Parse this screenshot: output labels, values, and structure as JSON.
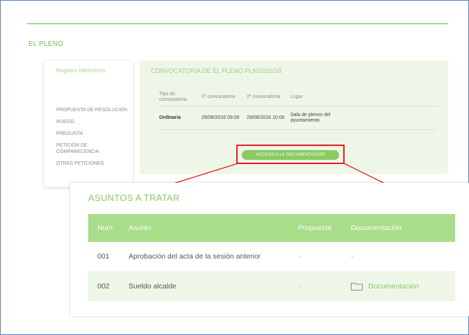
{
  "section_title": "EL PLENO",
  "sidebar": {
    "registro": "Registro electrónico",
    "items": [
      {
        "label": "PROPUESTA DE RESOLUCIÓN"
      },
      {
        "label": "RUEGO"
      },
      {
        "label": "PREGUNTA"
      },
      {
        "label": "PETICIÓN DE COMPARECENCIA"
      },
      {
        "label": "OTRAS PETICIONES"
      }
    ]
  },
  "convocatoria": {
    "title": "CONVOCATORIA DE EL PLENO PLN/2016/18",
    "headers": [
      "Tipo de convocatoria",
      "1ª convocatoria",
      "2ª convocatoria",
      "Lugar"
    ],
    "row": [
      "Ordinaria",
      "29/08/2016 09:00",
      "29/08/2016 10:00",
      "Sala de plenos del ayuntamiento"
    ],
    "button_label": "ACCESO A LA DOCUMENTACIÓN"
  },
  "asuntos": {
    "title": "ASUNTOS A TRATAR",
    "headers": [
      "Num.",
      "Asunto",
      "Propuesta",
      "Documentación"
    ],
    "rows": [
      {
        "num": "001",
        "asunto": "Aprobación del acta de la sesión anterior",
        "propuesta": "-",
        "documentacion": "-"
      },
      {
        "num": "002",
        "asunto": "Sueldo alcalde",
        "propuesta": "-",
        "documentacion": "Documentación"
      }
    ]
  },
  "colors": {
    "accent_green": "#8cc866",
    "header_green": "#a8dd8a",
    "highlight_red": "#e21c1c",
    "frame_blue": "#5b7fb5"
  }
}
